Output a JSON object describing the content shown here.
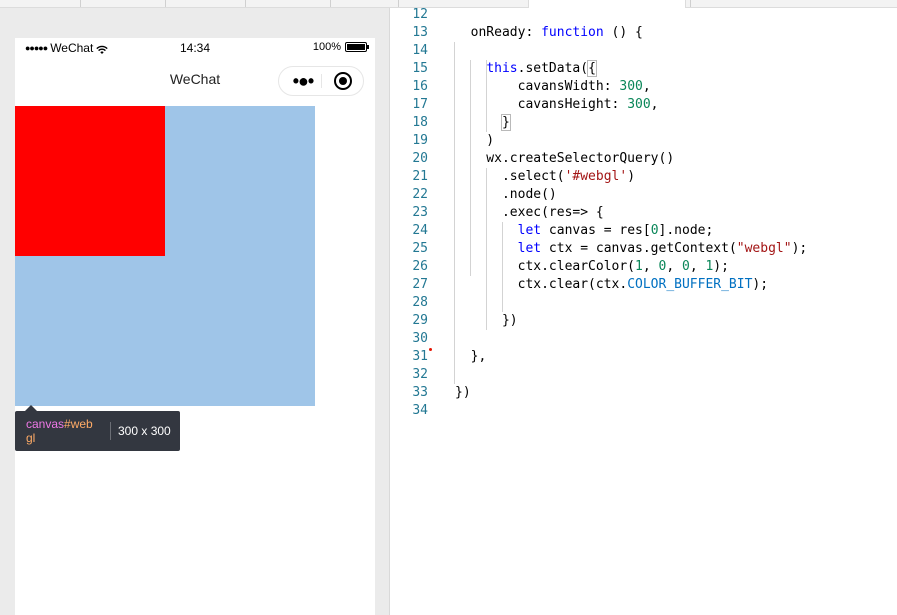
{
  "simulator": {
    "status": {
      "carrier": "WeChat",
      "time": "14:34",
      "battery": "100%"
    },
    "nav": {
      "title": "WeChat",
      "more_icon": "more-dots-icon",
      "close_icon": "target-circle-icon"
    },
    "canvas": {
      "clear_color": "#ff0000",
      "background_color": "#9fc5e8"
    },
    "tooltip": {
      "tag": "canvas",
      "id": "#webgl",
      "size": "300 x 300"
    }
  },
  "editor": {
    "lines": [
      {
        "n": "12",
        "tokens": []
      },
      {
        "n": "13",
        "tokens": [
          {
            "t": "  onReady: ",
            "c": "plain"
          },
          {
            "t": "function",
            "c": "kw"
          },
          {
            "t": " () {",
            "c": "plain"
          }
        ]
      },
      {
        "n": "14",
        "tokens": []
      },
      {
        "n": "15",
        "tokens": [
          {
            "t": "    ",
            "c": "plain"
          },
          {
            "t": "this",
            "c": "kw"
          },
          {
            "t": ".setData(",
            "c": "plain"
          },
          {
            "t": "{",
            "c": "plain",
            "box": true
          }
        ]
      },
      {
        "n": "16",
        "tokens": [
          {
            "t": "        cavansWidth: ",
            "c": "plain"
          },
          {
            "t": "300",
            "c": "num"
          },
          {
            "t": ",",
            "c": "plain"
          }
        ]
      },
      {
        "n": "17",
        "tokens": [
          {
            "t": "        cavansHeight: ",
            "c": "plain"
          },
          {
            "t": "300",
            "c": "num"
          },
          {
            "t": ",",
            "c": "plain"
          }
        ]
      },
      {
        "n": "18",
        "tokens": [
          {
            "t": "      ",
            "c": "plain"
          },
          {
            "t": "}",
            "c": "plain",
            "box": true
          }
        ]
      },
      {
        "n": "19",
        "tokens": [
          {
            "t": "    )",
            "c": "plain"
          }
        ]
      },
      {
        "n": "20",
        "tokens": [
          {
            "t": "    wx.createSelectorQuery()",
            "c": "plain"
          }
        ]
      },
      {
        "n": "21",
        "tokens": [
          {
            "t": "      .select(",
            "c": "plain"
          },
          {
            "t": "'#webgl'",
            "c": "str"
          },
          {
            "t": ")",
            "c": "plain"
          }
        ]
      },
      {
        "n": "22",
        "tokens": [
          {
            "t": "      .node()",
            "c": "plain"
          }
        ]
      },
      {
        "n": "23",
        "tokens": [
          {
            "t": "      .exec(res=> {",
            "c": "plain"
          }
        ]
      },
      {
        "n": "24",
        "tokens": [
          {
            "t": "        ",
            "c": "plain"
          },
          {
            "t": "let",
            "c": "kw"
          },
          {
            "t": " canvas = res[",
            "c": "plain"
          },
          {
            "t": "0",
            "c": "num"
          },
          {
            "t": "].node;",
            "c": "plain"
          }
        ]
      },
      {
        "n": "25",
        "tokens": [
          {
            "t": "        ",
            "c": "plain"
          },
          {
            "t": "let",
            "c": "kw"
          },
          {
            "t": " ctx = canvas.getContext(",
            "c": "plain"
          },
          {
            "t": "\"webgl\"",
            "c": "str"
          },
          {
            "t": ");",
            "c": "plain"
          }
        ]
      },
      {
        "n": "26",
        "tokens": [
          {
            "t": "        ctx.clearColor(",
            "c": "plain"
          },
          {
            "t": "1",
            "c": "num"
          },
          {
            "t": ", ",
            "c": "plain"
          },
          {
            "t": "0",
            "c": "num"
          },
          {
            "t": ", ",
            "c": "plain"
          },
          {
            "t": "0",
            "c": "num"
          },
          {
            "t": ", ",
            "c": "plain"
          },
          {
            "t": "1",
            "c": "num"
          },
          {
            "t": ");",
            "c": "plain"
          }
        ]
      },
      {
        "n": "27",
        "tokens": [
          {
            "t": "        ctx.clear(ctx.",
            "c": "plain"
          },
          {
            "t": "COLOR_BUFFER_BIT",
            "c": "const"
          },
          {
            "t": ");",
            "c": "plain"
          }
        ]
      },
      {
        "n": "28",
        "tokens": []
      },
      {
        "n": "29",
        "tokens": [
          {
            "t": "      })",
            "c": "plain"
          }
        ]
      },
      {
        "n": "30",
        "tokens": []
      },
      {
        "n": "31",
        "tokens": [
          {
            "t": "  },",
            "c": "plain"
          }
        ]
      },
      {
        "n": "32",
        "tokens": []
      },
      {
        "n": "33",
        "tokens": [
          {
            "t": "})",
            "c": "plain"
          }
        ]
      },
      {
        "n": "34",
        "tokens": []
      }
    ]
  }
}
